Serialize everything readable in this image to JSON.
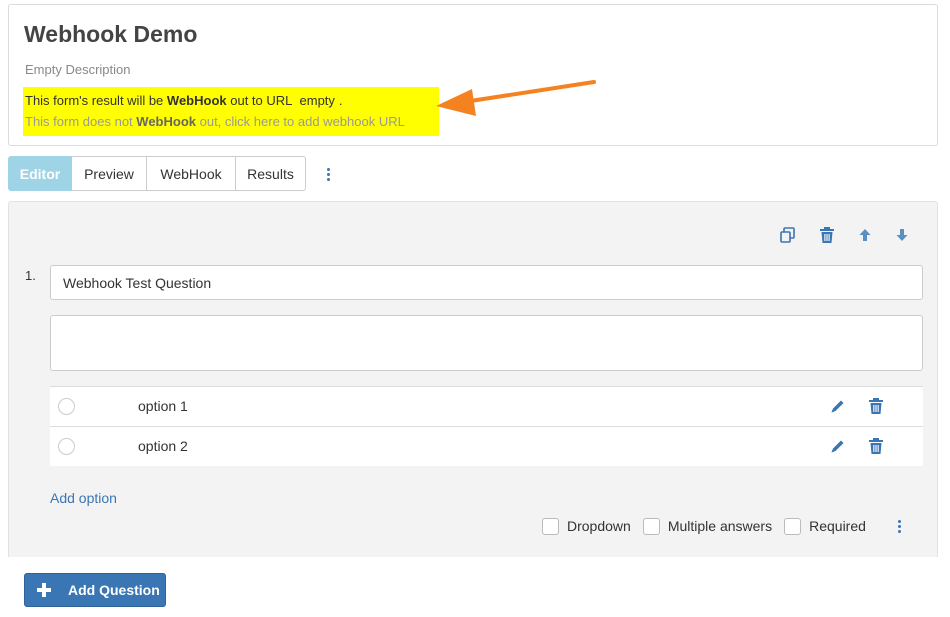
{
  "form": {
    "title": "Webhook Demo",
    "description": "Empty Description"
  },
  "webhook_notice": {
    "line1_prefix": "This form's result will be ",
    "line1_bold": "WebHook",
    "line1_middle": " out to URL ",
    "line1_url": "empty",
    "line1_suffix": ".",
    "line2_prefix": "This form does not ",
    "line2_bold": "WebHook",
    "line2_suffix": " out, click here to add webhook URL"
  },
  "annotation": {
    "arrow_color": "#f58220",
    "highlight_color": "#ffff00"
  },
  "tabs": [
    {
      "label": "Editor",
      "active": true
    },
    {
      "label": "Preview",
      "active": false
    },
    {
      "label": "WebHook",
      "active": false
    },
    {
      "label": "Results",
      "active": false
    }
  ],
  "toolbar_icons": [
    "copy-icon",
    "trash-icon",
    "arrow-up-icon",
    "arrow-down-icon"
  ],
  "question": {
    "number": "1.",
    "title_value": "Webhook Test Question",
    "description_value": "",
    "options": [
      {
        "label": "option 1"
      },
      {
        "label": "option 2"
      }
    ],
    "add_option_label": "Add option",
    "settings": [
      {
        "label": "Dropdown",
        "checked": false
      },
      {
        "label": "Multiple answers",
        "checked": false
      },
      {
        "label": "Required",
        "checked": false
      }
    ]
  },
  "add_question_label": "Add Question",
  "colors": {
    "primary": "#3a76b4",
    "active_tab": "#9fd4e6"
  }
}
